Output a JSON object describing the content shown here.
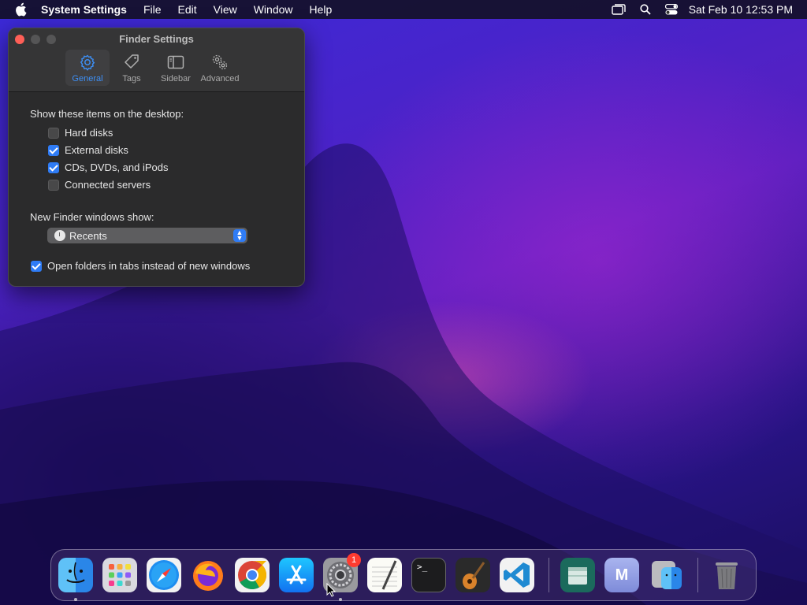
{
  "menubar": {
    "app_name": "System Settings",
    "menus": [
      "File",
      "Edit",
      "View",
      "Window",
      "Help"
    ],
    "clock": "Sat Feb 10  12:53 PM"
  },
  "window": {
    "title": "Finder Settings",
    "tabs": [
      {
        "label": "General",
        "icon": "gear-icon",
        "active": true
      },
      {
        "label": "Tags",
        "icon": "tag-icon",
        "active": false
      },
      {
        "label": "Sidebar",
        "icon": "sidebar-icon",
        "active": false
      },
      {
        "label": "Advanced",
        "icon": "gears-icon",
        "active": false
      }
    ],
    "desktop_section_label": "Show these items on the desktop:",
    "desktop_items": [
      {
        "label": "Hard disks",
        "checked": false
      },
      {
        "label": "External disks",
        "checked": true
      },
      {
        "label": "CDs, DVDs, and iPods",
        "checked": true
      },
      {
        "label": "Connected servers",
        "checked": false
      }
    ],
    "new_window_label": "New Finder windows show:",
    "new_window_value": "Recents",
    "open_in_tabs_label": "Open folders in tabs instead of new windows",
    "open_in_tabs_checked": true
  },
  "dock": {
    "apps": [
      {
        "name": "Finder",
        "icon": "finder-icon",
        "running": true
      },
      {
        "name": "Launchpad",
        "icon": "launchpad-icon",
        "running": false
      },
      {
        "name": "Safari",
        "icon": "safari-icon",
        "running": false
      },
      {
        "name": "Firefox",
        "icon": "firefox-icon",
        "running": false
      },
      {
        "name": "Chrome",
        "icon": "chrome-icon",
        "running": false
      },
      {
        "name": "App Store",
        "icon": "app-store-icon",
        "running": false
      },
      {
        "name": "System Settings",
        "icon": "system-settings-icon",
        "running": true,
        "badge": "1"
      },
      {
        "name": "TextEdit",
        "icon": "textedit-icon",
        "running": false
      },
      {
        "name": "Terminal",
        "icon": "terminal-icon",
        "running": false
      },
      {
        "name": "GarageBand",
        "icon": "garageband-icon",
        "running": false
      },
      {
        "name": "VS Code",
        "icon": "vscode-icon",
        "running": false
      }
    ],
    "recent": [
      {
        "name": "Archive Utility",
        "icon": "archive-icon"
      },
      {
        "name": "M App",
        "icon": "m-app-icon",
        "letter": "M"
      },
      {
        "name": "Finder Settings",
        "icon": "finder-folder-icon"
      }
    ],
    "trash": {
      "name": "Trash",
      "icon": "trash-icon"
    },
    "terminal_prompt": ">_"
  },
  "colors": {
    "accent": "#2f7cf6",
    "close": "#ff5f57",
    "badge": "#ff3b30"
  }
}
